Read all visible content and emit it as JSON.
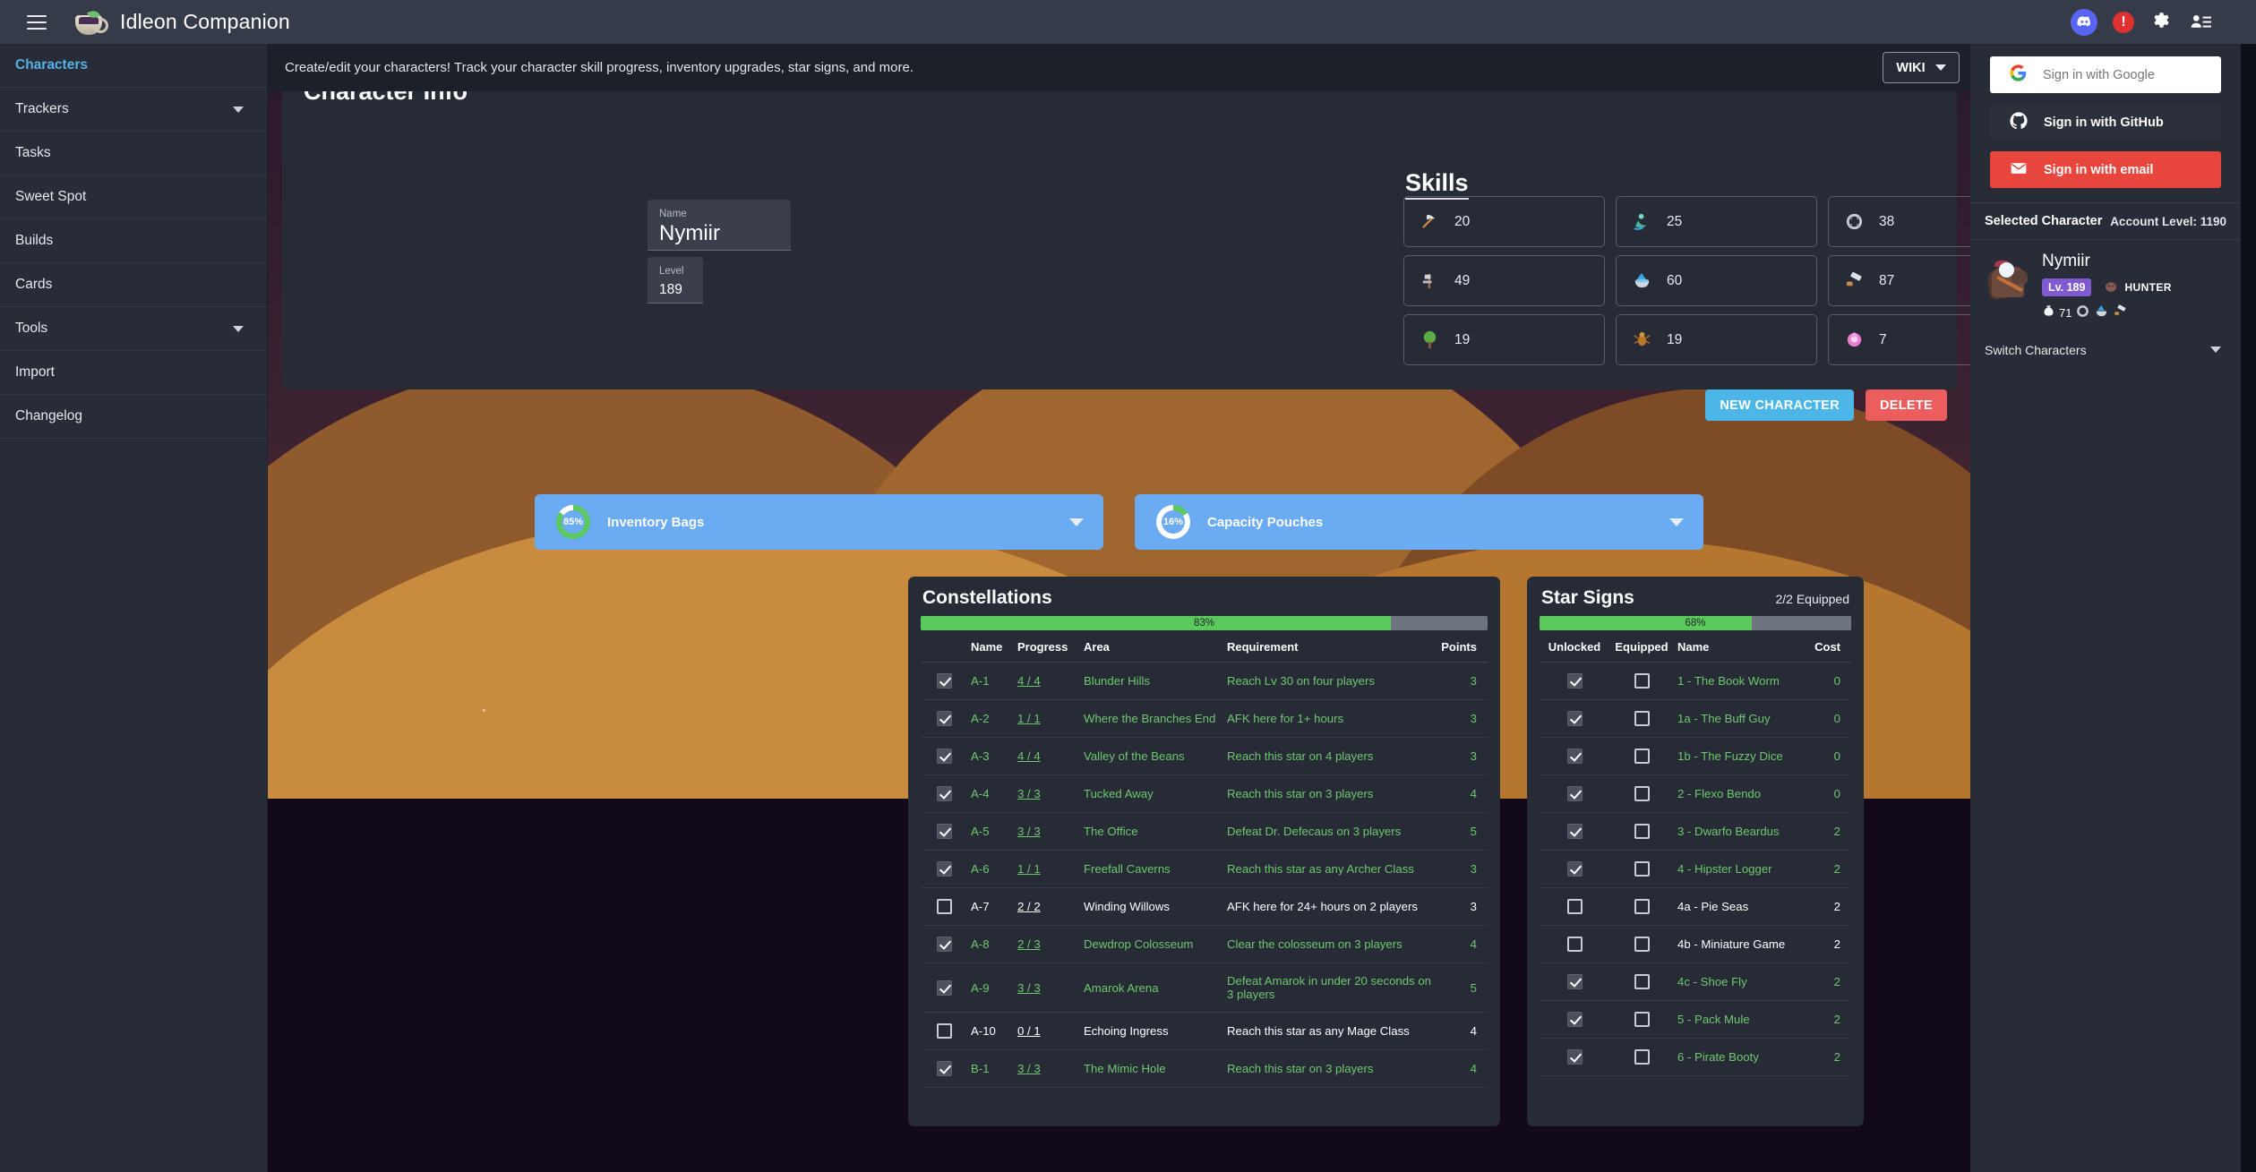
{
  "app": {
    "brand": "Idleon Companion",
    "logo_icon": "coffee-cup-icon",
    "menu_icon": "hamburger-menu-icon"
  },
  "topbar_icons": [
    {
      "name": "discord-icon",
      "glyph": "discord"
    },
    {
      "name": "alert-icon",
      "glyph": "!"
    },
    {
      "name": "gear-icon",
      "glyph": "gear"
    },
    {
      "name": "account-list-icon",
      "glyph": "person-list"
    }
  ],
  "sidebar": {
    "items": [
      {
        "label": "Characters",
        "active": true,
        "expandable": false
      },
      {
        "label": "Trackers",
        "active": false,
        "expandable": true
      },
      {
        "label": "Tasks",
        "active": false,
        "expandable": false
      },
      {
        "label": "Sweet Spot",
        "active": false,
        "expandable": false
      },
      {
        "label": "Builds",
        "active": false,
        "expandable": false
      },
      {
        "label": "Cards",
        "active": false,
        "expandable": false
      },
      {
        "label": "Tools",
        "active": false,
        "expandable": true
      },
      {
        "label": "Import",
        "active": false,
        "expandable": false
      },
      {
        "label": "Changelog",
        "active": false,
        "expandable": false
      }
    ]
  },
  "header": {
    "description": "Create/edit your characters! Track your character skill progress, inventory upgrades, star signs, and more.",
    "wiki_label": "WIKI"
  },
  "character_info": {
    "title": "Character Info",
    "name_label": "Name",
    "name_value": "Nymiir",
    "level_label": "Level",
    "level_value": "189",
    "new_character_label": "NEW CHARACTER",
    "delete_label": "DELETE"
  },
  "skills": {
    "title": "Skills",
    "items": [
      {
        "icon": "mining-pickaxe-icon",
        "value": "20"
      },
      {
        "icon": "fishing-icon",
        "value": "25"
      },
      {
        "icon": "trapping-icon",
        "value": "38"
      },
      {
        "icon": "chopping-axe-icon",
        "value": "49"
      },
      {
        "icon": "alchemy-cauldron-icon",
        "value": "60"
      },
      {
        "icon": "construction-icon",
        "value": "87"
      },
      {
        "icon": "tree-icon",
        "value": "19"
      },
      {
        "icon": "catching-bug-icon",
        "value": "19"
      },
      {
        "icon": "worship-icon",
        "value": "7"
      }
    ]
  },
  "collapsibles": [
    {
      "label": "Inventory Bags",
      "percent": "85%",
      "percent_value": 85
    },
    {
      "label": "Capacity Pouches",
      "percent": "16%",
      "percent_value": 16
    }
  ],
  "constellations": {
    "title": "Constellations",
    "progress_text": "83%",
    "progress_value": 83,
    "columns": [
      "",
      "Name",
      "Progress",
      "Area",
      "Requirement",
      "Points"
    ],
    "rows": [
      {
        "checked": true,
        "name": "A-1",
        "progress": "4 / 4",
        "area": "Blunder Hills",
        "requirement": "Reach Lv 30 on four players",
        "points": "3"
      },
      {
        "checked": true,
        "name": "A-2",
        "progress": "1 / 1",
        "area": "Where the Branches End",
        "requirement": "AFK here for 1+ hours",
        "points": "3"
      },
      {
        "checked": true,
        "name": "A-3",
        "progress": "4 / 4",
        "area": "Valley of the Beans",
        "requirement": "Reach this star on 4 players",
        "points": "3"
      },
      {
        "checked": true,
        "name": "A-4",
        "progress": "3 / 3",
        "area": "Tucked Away",
        "requirement": "Reach this star on 3 players",
        "points": "4"
      },
      {
        "checked": true,
        "name": "A-5",
        "progress": "3 / 3",
        "area": "The Office",
        "requirement": "Defeat Dr. Defecaus on 3 players",
        "points": "5"
      },
      {
        "checked": true,
        "name": "A-6",
        "progress": "1 / 1",
        "area": "Freefall Caverns",
        "requirement": "Reach this star as any Archer Class",
        "points": "3"
      },
      {
        "checked": false,
        "name": "A-7",
        "progress": "2 / 2",
        "area": "Winding Willows",
        "requirement": "AFK here for 24+ hours on 2 players",
        "points": "3"
      },
      {
        "checked": true,
        "name": "A-8",
        "progress": "2 / 3",
        "area": "Dewdrop Colosseum",
        "requirement": "Clear the colosseum on 3 players",
        "points": "4"
      },
      {
        "checked": true,
        "name": "A-9",
        "progress": "3 / 3",
        "area": "Amarok Arena",
        "requirement": "Defeat Amarok in under 20 seconds on 3 players",
        "points": "5"
      },
      {
        "checked": false,
        "name": "A-10",
        "progress": "0 / 1",
        "area": "Echoing Ingress",
        "requirement": "Reach this star as any Mage Class",
        "points": "4"
      },
      {
        "checked": true,
        "name": "B-1",
        "progress": "3 / 3",
        "area": "The Mimic Hole",
        "requirement": "Reach this star on 3 players",
        "points": "4"
      }
    ]
  },
  "star_signs": {
    "title": "Star Signs",
    "equipped_text": "2/2 Equipped",
    "progress_text": "68%",
    "progress_value": 68,
    "columns": [
      "Unlocked",
      "Equipped",
      "Name",
      "Cost"
    ],
    "rows": [
      {
        "unlocked": true,
        "equipped": false,
        "name": "1 - The Book Worm",
        "cost": "0"
      },
      {
        "unlocked": true,
        "equipped": false,
        "name": "1a - The Buff Guy",
        "cost": "0"
      },
      {
        "unlocked": true,
        "equipped": false,
        "name": "1b - The Fuzzy Dice",
        "cost": "0"
      },
      {
        "unlocked": true,
        "equipped": false,
        "name": "2 - Flexo Bendo",
        "cost": "0"
      },
      {
        "unlocked": true,
        "equipped": false,
        "name": "3 - Dwarfo Beardus",
        "cost": "2"
      },
      {
        "unlocked": true,
        "equipped": false,
        "name": "4 - Hipster Logger",
        "cost": "2"
      },
      {
        "unlocked": false,
        "equipped": false,
        "name": "4a - Pie Seas",
        "cost": "2"
      },
      {
        "unlocked": false,
        "equipped": false,
        "name": "4b - Miniature Game",
        "cost": "2"
      },
      {
        "unlocked": true,
        "equipped": false,
        "name": "4c - Shoe Fly",
        "cost": "2"
      },
      {
        "unlocked": true,
        "equipped": false,
        "name": "5 - Pack Mule",
        "cost": "2"
      },
      {
        "unlocked": true,
        "equipped": false,
        "name": "6 - Pirate Booty",
        "cost": "2"
      }
    ]
  },
  "auth": {
    "google_label": "Sign in with Google",
    "github_label": "Sign in with GitHub",
    "email_label": "Sign in with email"
  },
  "selected_character": {
    "header_label": "Selected Character",
    "account_level_label": "Account Level: 1190",
    "name": "Nymiir",
    "level_badge": "Lv. 189",
    "class_name": "HUNTER",
    "class_icon": "hunter-pet-icon",
    "stat_icon": "money-bag-icon",
    "stat_value": "71",
    "extra_icons": [
      "trapping-icon",
      "alchemy-cauldron-icon",
      "construction-icon"
    ],
    "switch_label": "Switch Characters"
  },
  "colors": {
    "accent_blue": "#57b0e6",
    "progress_green": "#5cc95c",
    "danger_red": "#ec5d5d",
    "collapse_blue": "#6aabf2",
    "level_purple": "#7f5ad1"
  }
}
